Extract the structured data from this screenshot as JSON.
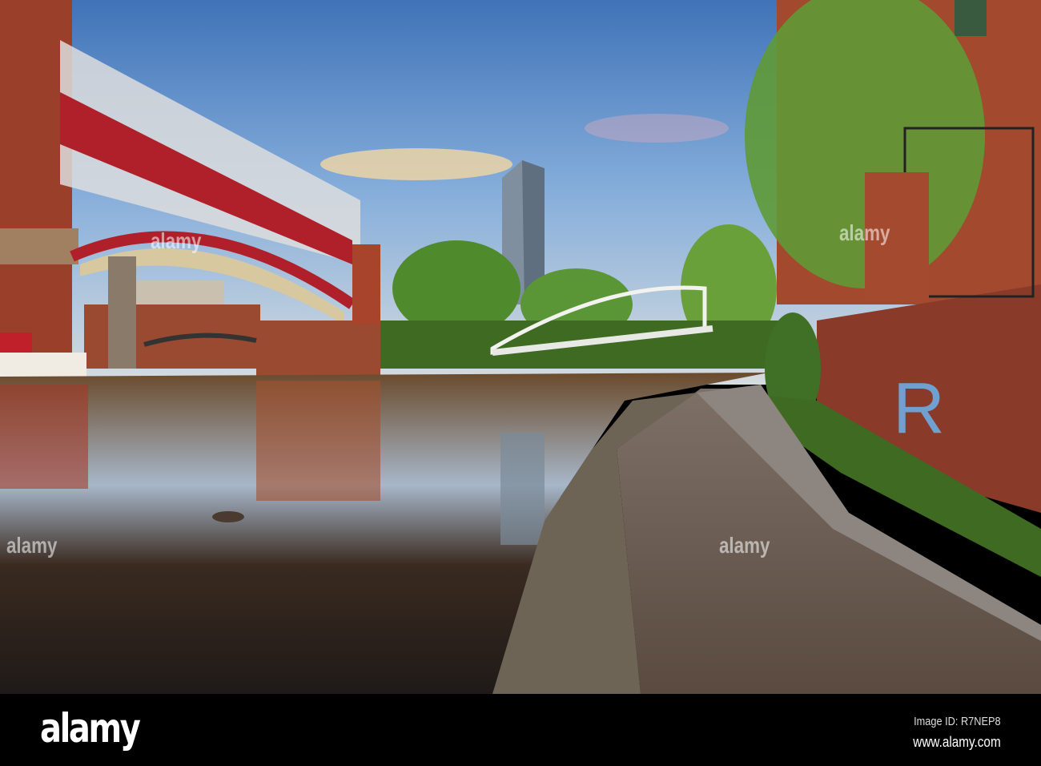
{
  "photo": {
    "subject": "canal"
  },
  "watermark": {
    "text": "alamy"
  },
  "footer": {
    "logo": "alamy",
    "image_id": "Image ID: R7NEP8",
    "website": "www.alamy.com"
  },
  "colors": {
    "bar": "#000000",
    "sky": "#6f9fd0",
    "brick": "#9a3f2a",
    "bridge_red": "#b0202a",
    "foliage": "#4f8a2c"
  }
}
